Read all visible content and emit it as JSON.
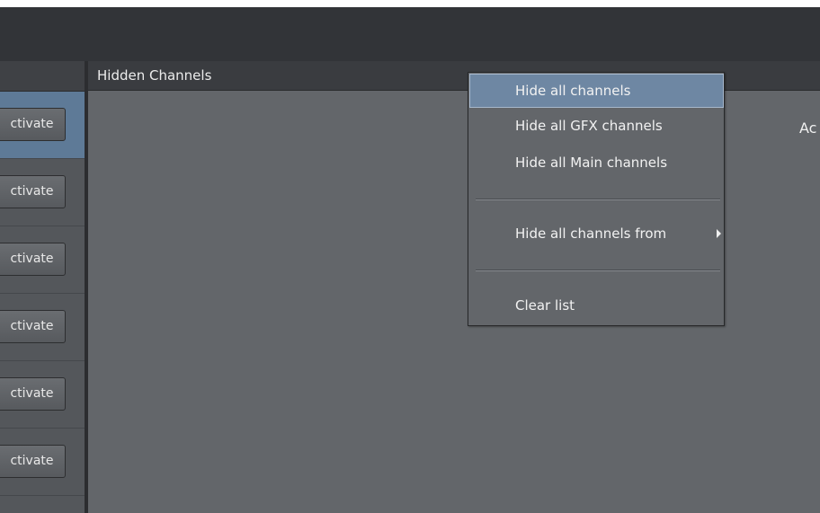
{
  "left_panel": {
    "rows": [
      {
        "button_label": "ctivate",
        "selected": true
      },
      {
        "button_label": "ctivate",
        "selected": false
      },
      {
        "button_label": "ctivate",
        "selected": false
      },
      {
        "button_label": "ctivate",
        "selected": false
      },
      {
        "button_label": "ctivate",
        "selected": false
      },
      {
        "button_label": "ctivate",
        "selected": false
      }
    ]
  },
  "main": {
    "title": "Hidden Channels",
    "right_label": "Ac"
  },
  "context_menu": {
    "items": [
      {
        "label": "Hide all channels",
        "highlighted": true
      },
      {
        "label": "Hide all GFX channels"
      },
      {
        "label": "Hide all Main channels"
      },
      {
        "label": "Hide all channels from",
        "has_submenu": true
      },
      {
        "label": "Clear list"
      }
    ]
  },
  "colors": {
    "highlight": "#6e87a3",
    "selected_row": "#5e7a97",
    "panel_bg": "#63666a",
    "header_bg": "#3a3c40"
  }
}
